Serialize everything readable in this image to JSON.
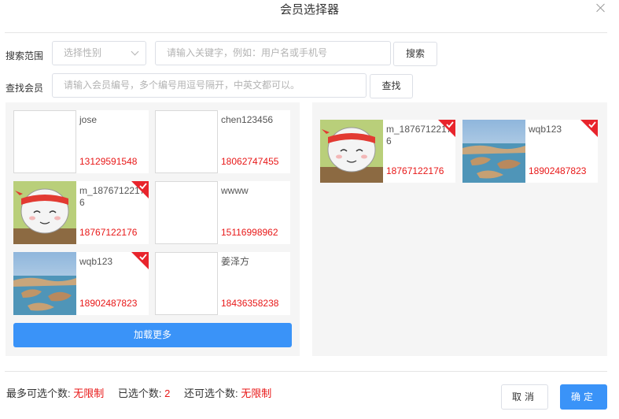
{
  "dialog": {
    "title": "会员选择器"
  },
  "search": {
    "range_label": "搜索范围",
    "gender_placeholder": "选择性别",
    "keyword_placeholder": "请输入关键字，例如：用户名或手机号",
    "search_button": "搜索",
    "find_label": "查找会员",
    "ids_placeholder": "请输入会员编号，多个编号用逗号隔开，中英文都可以。",
    "find_button": "查找"
  },
  "left_list": {
    "members": [
      {
        "name": "jose",
        "phone": "13129591548",
        "avatar": "empty",
        "selected": false
      },
      {
        "name": "chen123456",
        "phone": "18062747455",
        "avatar": "empty",
        "selected": false
      },
      {
        "name": "m_18767122176",
        "phone": "18767122176",
        "avatar": "cartoon",
        "selected": true
      },
      {
        "name": "wwww",
        "phone": "15116998962",
        "avatar": "empty",
        "selected": false
      },
      {
        "name": "wqb123",
        "phone": "18902487823",
        "avatar": "landscape",
        "selected": true
      },
      {
        "name": "姜泽方",
        "phone": "18436358238",
        "avatar": "empty",
        "selected": false
      }
    ],
    "load_more": "加载更多"
  },
  "right_list": {
    "members": [
      {
        "name": "m_18767122176",
        "phone": "18767122176",
        "avatar": "cartoon",
        "selected": true
      },
      {
        "name": "wqb123",
        "phone": "18902487823",
        "avatar": "landscape",
        "selected": true
      }
    ]
  },
  "footer": {
    "max_label": "最多可选个数:",
    "max_value": "无限制",
    "selected_label": "已选个数:",
    "selected_value": "2",
    "remaining_label": "还可选个数:",
    "remaining_value": "无限制",
    "cancel": "取消",
    "confirm": "确定"
  },
  "colors": {
    "accent": "#3a93f8",
    "phone": "#e81818",
    "check_badge": "#e8242c",
    "panel_bg": "#f5f5f5"
  }
}
